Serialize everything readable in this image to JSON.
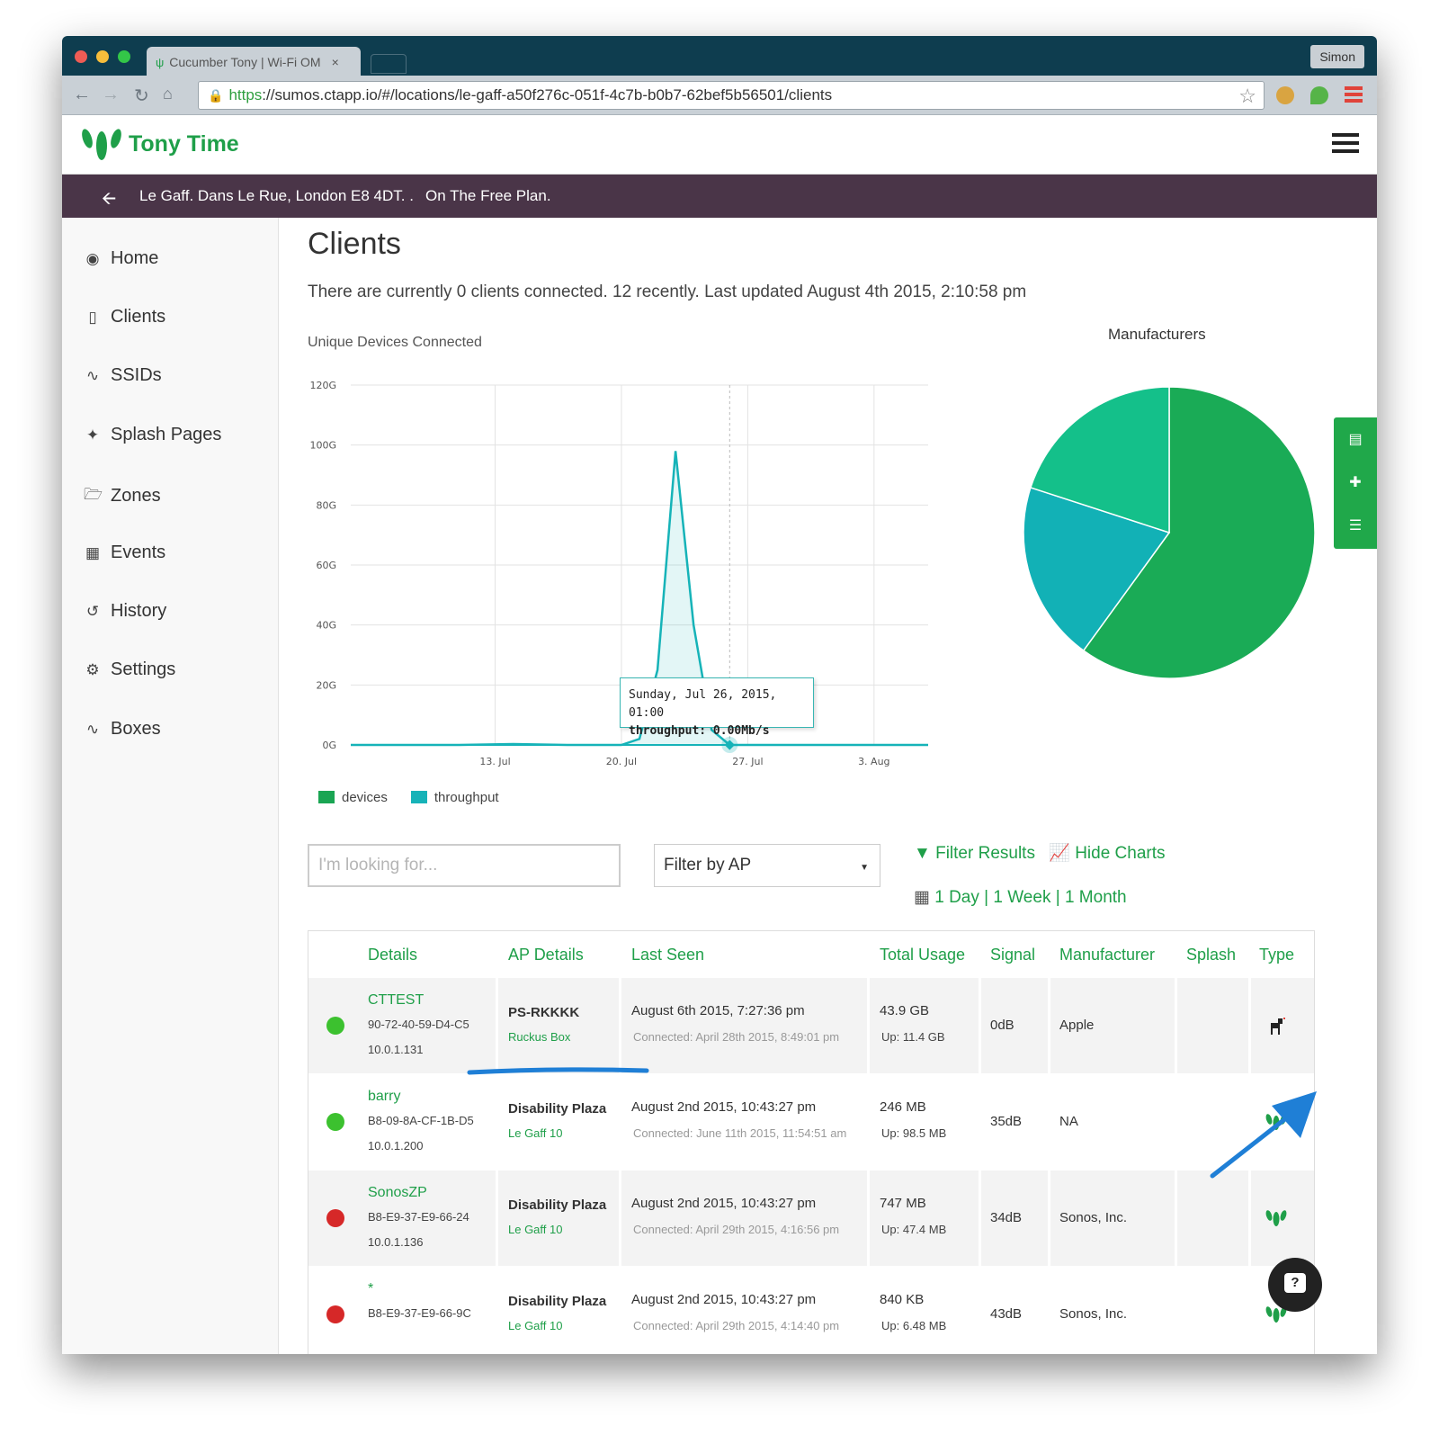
{
  "browser": {
    "tab_title": "Cucumber Tony | Wi-Fi OM",
    "tab_close": "×",
    "user_button": "Simon",
    "url_scheme": "https",
    "url_rest": "://sumos.ctapp.io/#/locations/le-gaff-a50f276c-051f-4c7b-b0b7-62bef5b56501/clients"
  },
  "app": {
    "brand": "Tony Time",
    "location_address": "Le Gaff. Dans Le Rue, London E8 4DT. .",
    "plan": "On The Free Plan."
  },
  "sidebar": {
    "items": [
      {
        "label": "Home",
        "icon": "dashboard-icon"
      },
      {
        "label": "Clients",
        "icon": "tablet-icon"
      },
      {
        "label": "SSIDs",
        "icon": "wifi-icon"
      },
      {
        "label": "Splash Pages",
        "icon": "magic-wand-icon"
      },
      {
        "label": "Zones",
        "icon": "folder-icon"
      },
      {
        "label": "Events",
        "icon": "calendar-icon"
      },
      {
        "label": "History",
        "icon": "history-icon"
      },
      {
        "label": "Settings",
        "icon": "gears-icon"
      },
      {
        "label": "Boxes",
        "icon": "wifi-icon"
      }
    ]
  },
  "main": {
    "title": "Clients",
    "summary": "There are currently 0 clients connected. 12 recently. Last updated August 4th 2015, 2:10:58 pm",
    "search_placeholder": "I'm looking for...",
    "filter_ap": "Filter by AP",
    "filter_results": "Filter Results",
    "hide_charts": "Hide Charts",
    "range_1day": "1 Day",
    "range_1week": "1 Week",
    "range_1month": "1 Month",
    "range_sep": "|"
  },
  "tooltip": {
    "date": "Sunday, Jul 26, 2015, 01:00",
    "label": "throughput:",
    "value": "0.00Mb/s"
  },
  "colors": {
    "brand_green": "#1f9f49",
    "devices": "#1aa553",
    "throughput": "#16b3b8",
    "pie_1": "#1aab56",
    "pie_2": "#12b1b6",
    "pie_3": "#14c08a",
    "status_online": "#3cc12f",
    "status_offline": "#d62828"
  },
  "chart_data": [
    {
      "type": "area",
      "title": "Unique Devices Connected",
      "x": [
        "2015-07-05",
        "2015-07-08",
        "2015-07-11",
        "2015-07-14",
        "2015-07-17",
        "2015-07-19",
        "2015-07-20",
        "2015-07-21",
        "2015-07-22",
        "2015-07-23",
        "2015-07-24",
        "2015-07-25",
        "2015-07-26",
        "2015-07-28",
        "2015-07-31",
        "2015-08-03",
        "2015-08-06"
      ],
      "series": [
        {
          "name": "devices",
          "values": [
            0,
            0,
            0,
            0.3,
            0,
            0,
            0,
            2,
            25,
            98,
            40,
            5,
            0,
            0,
            0,
            0,
            0
          ]
        },
        {
          "name": "throughput",
          "values": [
            0,
            0,
            0,
            0,
            0,
            0,
            0,
            0,
            0,
            0,
            0,
            0,
            0,
            0,
            0,
            0,
            0
          ]
        }
      ],
      "yticks": [
        "0G",
        "20G",
        "40G",
        "60G",
        "80G",
        "100G",
        "120G"
      ],
      "xticks": [
        "13. Jul",
        "20. Jul",
        "27. Jul",
        "3. Aug"
      ],
      "ylim": [
        0,
        120
      ],
      "grid": true,
      "legend": "bottom-left"
    },
    {
      "type": "pie",
      "title": "Manufacturers",
      "values": [
        0.6,
        0.2,
        0.2
      ]
    }
  ],
  "table": {
    "headers": [
      "Details",
      "AP Details",
      "Last Seen",
      "Total Usage",
      "Signal",
      "Manufacturer",
      "Splash",
      "Type"
    ],
    "rows": [
      {
        "status": "online",
        "name": "CTTEST",
        "mac": "90-72-40-59-D4-C5",
        "ip": "10.0.1.131",
        "ap": "PS-RKKKK",
        "ap_sub": "Ruckus Box",
        "last_seen": "August 6th 2015, 7:27:36 pm",
        "connected": "Connected: April 28th 2015, 8:49:01 pm",
        "usage": "43.9 GB",
        "up": "Up: 11.4 GB",
        "signal": "0dB",
        "manufacturer": "Apple",
        "type_icon": "dog-icon"
      },
      {
        "status": "online",
        "name": "barry",
        "mac": "B8-09-8A-CF-1B-D5",
        "ip": "10.0.1.200",
        "ap": "Disability Plaza",
        "ap_sub": "Le Gaff 10",
        "last_seen": "August 2nd 2015, 10:43:27 pm",
        "connected": "Connected: June 11th 2015, 11:54:51 am",
        "usage": "246 MB",
        "up": "Up: 98.5 MB",
        "signal": "35dB",
        "manufacturer": "NA",
        "type_icon": "cucumber-logo-icon"
      },
      {
        "status": "offline",
        "name": "SonosZP",
        "mac": "B8-E9-37-E9-66-24",
        "ip": "10.0.1.136",
        "ap": "Disability Plaza",
        "ap_sub": "Le Gaff 10",
        "last_seen": "August 2nd 2015, 10:43:27 pm",
        "connected": "Connected: April 29th 2015, 4:16:56 pm",
        "usage": "747 MB",
        "up": "Up: 47.4 MB",
        "signal": "34dB",
        "manufacturer": "Sonos, Inc.",
        "type_icon": "cucumber-logo-icon"
      },
      {
        "status": "offline",
        "name": "*",
        "mac": "B8-E9-37-E9-66-9C",
        "ip": "",
        "ap": "Disability Plaza",
        "ap_sub": "Le Gaff 10",
        "last_seen": "August 2nd 2015, 10:43:27 pm",
        "connected": "Connected: April 29th 2015, 4:14:40 pm",
        "usage": "840 KB",
        "up": "Up: 6.48 MB",
        "signal": "43dB",
        "manufacturer": "Sonos, Inc.",
        "type_icon": "cucumber-logo-icon"
      }
    ]
  }
}
